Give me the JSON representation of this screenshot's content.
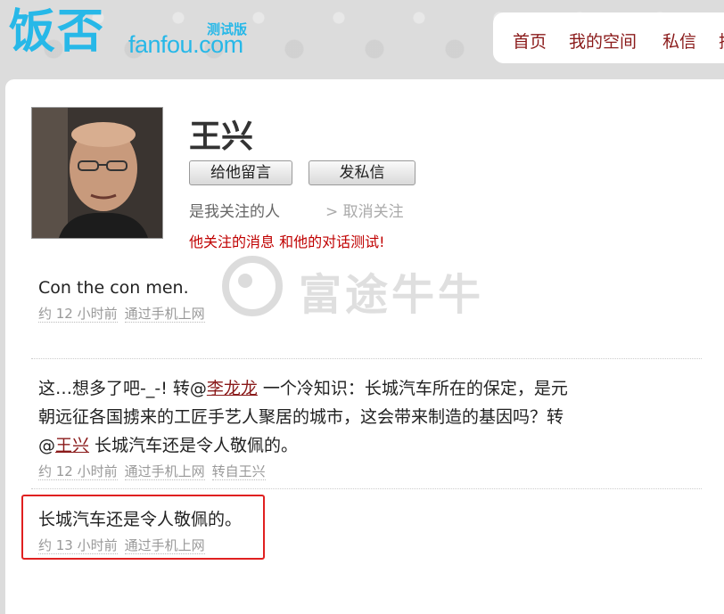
{
  "logo": {
    "cn": "饭否",
    "en": "fanfou.com",
    "beta": "测试版"
  },
  "nav": {
    "items": [
      "首页",
      "我的空间",
      "私信",
      "搜"
    ]
  },
  "profile": {
    "name": "王兴",
    "buttons": {
      "message": "给他留言",
      "dm": "发私信"
    },
    "follow_status": "是我关注的人",
    "unfollow": "> 取消关注",
    "subtitle": "他关注的消息 和他的对话测试!"
  },
  "watermark": "富途牛牛",
  "statuses": [
    {
      "text": "Con the con men.",
      "time": "约 12 小时前",
      "via": "通过手机上网"
    },
    {
      "line1_pre": "这…想多了吧-_-! 转@",
      "line1_link": "李龙龙",
      "line1_post": " 一个冷知识：长城汽车所在的保定，是元",
      "line2": "朝远征各国掳来的工匠手艺人聚居的城市，这会带来制造的基因吗？转",
      "line3_pre": "@",
      "line3_link": "王兴",
      "line3_post": " 长城汽车还是令人敬佩的。",
      "time": "约 12 小时前",
      "via": "通过手机上网",
      "repost": "转自王兴"
    },
    {
      "text": "长城汽车还是令人敬佩的。",
      "time": "约 13 小时前",
      "via": "通过手机上网"
    }
  ]
}
